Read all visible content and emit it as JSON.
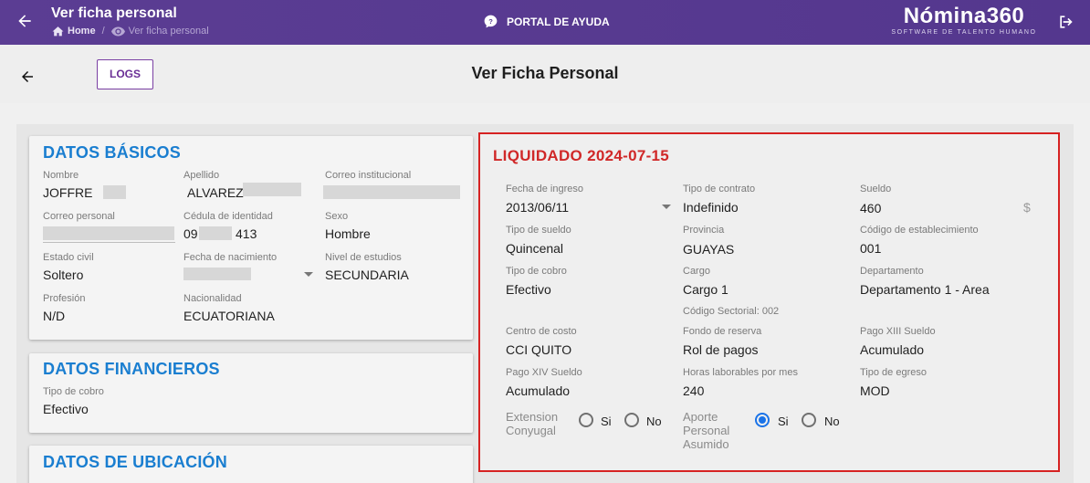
{
  "topbar": {
    "title": "Ver ficha personal",
    "breadcrumb_home": "Home",
    "breadcrumb_separator": "/",
    "breadcrumb_current": "Ver ficha personal",
    "help_label": "PORTAL DE AYUDA",
    "brand_name": "Nómina360",
    "brand_tagline": "SOFTWARE DE TALENTO HUMANO",
    "icons": [
      "back-arrow-icon",
      "home-icon",
      "eye-icon",
      "help-circle-icon",
      "logout-icon"
    ]
  },
  "header": {
    "logs_button": "LOGS",
    "page_title": "Ver Ficha Personal"
  },
  "basic_data": {
    "title": "DATOS BÁSICOS",
    "nombre_label": "Nombre",
    "nombre_value": "JOFFRE",
    "apellido_label": "Apellido",
    "apellido_value": "ALVAREZ",
    "correo_institucional_label": "Correo institucional",
    "correo_personal_label": "Correo personal",
    "cedula_label": "Cédula de identidad",
    "cedula_prefix": "09",
    "cedula_suffix": "413",
    "sexo_label": "Sexo",
    "sexo_value": "Hombre",
    "estado_civil_label": "Estado civil",
    "estado_civil_value": "Soltero",
    "fecha_nacimiento_label": "Fecha de nacimiento",
    "nivel_estudios_label": "Nivel de estudios",
    "nivel_estudios_value": "SECUNDARIA",
    "profesion_label": "Profesión",
    "profesion_value": "N/D",
    "nacionalidad_label": "Nacionalidad",
    "nacionalidad_value": "ECUATORIANA"
  },
  "financial_data": {
    "title": "DATOS FINANCIEROS",
    "tipo_cobro_label": "Tipo de cobro",
    "tipo_cobro_value": "Efectivo"
  },
  "location_data": {
    "title": "DATOS DE UBICACIÓN"
  },
  "liquidation": {
    "title": "LIQUIDADO 2024-07-15",
    "fecha_ingreso_label": "Fecha de ingreso",
    "fecha_ingreso_value": "2013/06/11",
    "tipo_contrato_label": "Tipo de contrato",
    "tipo_contrato_value": "Indefinido",
    "sueldo_label": "Sueldo",
    "sueldo_value": "460",
    "currency_symbol": "$",
    "tipo_sueldo_label": "Tipo de sueldo",
    "tipo_sueldo_value": "Quincenal",
    "provincia_label": "Provincia",
    "provincia_value": "GUAYAS",
    "codigo_establecimiento_label": "Código de establecimiento",
    "codigo_establecimiento_value": "001",
    "tipo_cobro_label": "Tipo de cobro",
    "tipo_cobro_value": "Efectivo",
    "cargo_label": "Cargo",
    "cargo_value": "Cargo 1",
    "codigo_sectorial": "Código Sectorial: 002",
    "departamento_label": "Departamento",
    "departamento_value": "Departamento 1 - Area",
    "centro_costo_label": "Centro de costo",
    "centro_costo_value": "CCI QUITO",
    "fondo_reserva_label": "Fondo de reserva",
    "fondo_reserva_value": "Rol de pagos",
    "pago_xiii_label": "Pago XIII Sueldo",
    "pago_xiii_value": "Acumulado",
    "pago_xiv_label": "Pago XIV Sueldo",
    "pago_xiv_value": "Acumulado",
    "horas_label": "Horas laborables por mes",
    "horas_value": "240",
    "tipo_egreso_label": "Tipo de egreso",
    "tipo_egreso_value": "MOD",
    "extension_line1": "Extension",
    "extension_line2": "Conyugal",
    "aporte_line1": "Aporte",
    "aporte_line2": "Personal",
    "aporte_line3": "Asumido",
    "si_label": "Si",
    "no_label": "No",
    "extension_selected": "none",
    "aporte_selected": "Si"
  },
  "colors": {
    "topbar": "#5b3d93",
    "section_title": "#1a7ed0",
    "liquidated_red": "#d02828",
    "radio_selected": "#1a73e8"
  }
}
